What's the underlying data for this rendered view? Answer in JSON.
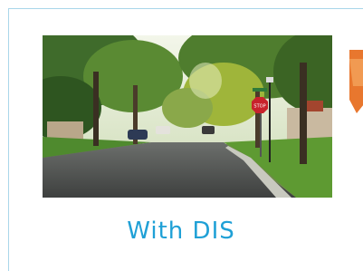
{
  "caption": "With DIS",
  "colors": {
    "caption": "#1fa0d6",
    "card_border": "#a9d6ea",
    "peek_accent": "#e8772e"
  },
  "image": {
    "subject": "residential-street-photo",
    "sign_text": "STOP"
  }
}
